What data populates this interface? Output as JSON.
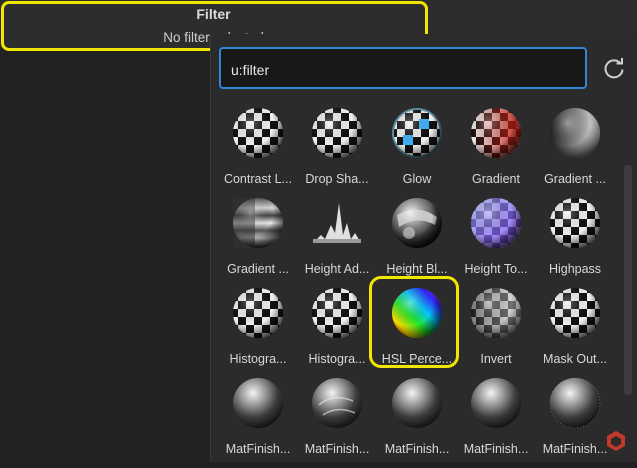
{
  "header": {
    "title": "Filter",
    "subtitle": "No filter selected"
  },
  "search": {
    "value": "u:filter"
  },
  "colors": {
    "highlight": "#f2e600",
    "accent": "#2f86d6",
    "badge": "#c0392b"
  },
  "filters": [
    {
      "label": "Contrast L...",
      "icon": "checker-sphere"
    },
    {
      "label": "Drop Sha...",
      "icon": "checker-sphere"
    },
    {
      "label": "Glow",
      "icon": "checker-glow-sphere"
    },
    {
      "label": "Gradient",
      "icon": "red-gradient-sphere"
    },
    {
      "label": "Gradient ...",
      "icon": "grey-gradient-sphere"
    },
    {
      "label": "Gradient ...",
      "icon": "striped-sphere"
    },
    {
      "label": "Height Ad...",
      "icon": "height-peaks"
    },
    {
      "label": "Height Bl...",
      "icon": "chrome-ball"
    },
    {
      "label": "Height To...",
      "icon": "normal-checker-sphere"
    },
    {
      "label": "Highpass",
      "icon": "checker-sphere"
    },
    {
      "label": "Histogra...",
      "icon": "checker-sphere"
    },
    {
      "label": "Histogra...",
      "icon": "checker-sphere"
    },
    {
      "label": "HSL Perce...",
      "icon": "hue-sphere"
    },
    {
      "label": "Invert",
      "icon": "inverted-sphere"
    },
    {
      "label": "Mask Out...",
      "icon": "checker-sphere"
    },
    {
      "label": "MatFinish...",
      "icon": "metal-sphere"
    },
    {
      "label": "MatFinish...",
      "icon": "scratched-metal-sphere"
    },
    {
      "label": "MatFinish...",
      "icon": "metal-sphere"
    },
    {
      "label": "MatFinish...",
      "icon": "metal-sphere"
    },
    {
      "label": "MatFinish...",
      "icon": "brushed-metal-sphere"
    }
  ]
}
